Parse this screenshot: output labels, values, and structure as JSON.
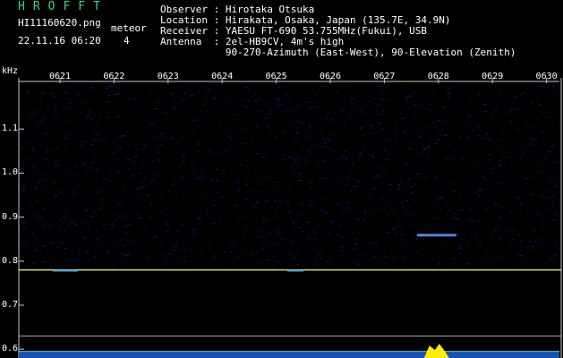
{
  "header": {
    "brand": "HROFFT",
    "filename": "HI11160620.png",
    "datetime": "22.11.16 06:20",
    "meteor_label": "meteor",
    "meteor_count": "4"
  },
  "observer_info": {
    "observer": "Observer : Hirotaka Otsuka",
    "location": "Location : Hirakata, Osaka, Japan (135.7E, 34.9N)",
    "receiver": "Receiver : YAESU FT-690 53.755MHz(Fukui), USB",
    "antenna": "Antenna  : 2el-HB9CV, 4m's high",
    "antenna_2": "           90-270-Azimuth (East-West), 90-Elevation (Zenith)"
  },
  "chart_data": {
    "type": "heatmap",
    "ylabel": "kHz",
    "x_ticks": [
      "0621",
      "0622",
      "0623",
      "0624",
      "0625",
      "0626",
      "0627",
      "0628",
      "0629",
      "0630"
    ],
    "y_ticks": [
      "1.1",
      "1.0",
      "0.9",
      "0.8",
      "0.7",
      "0.6"
    ],
    "ylim": [
      0.58,
      1.2
    ],
    "signals": [
      {
        "freq_khz": 0.78,
        "kind": "carrier"
      },
      {
        "freq_khz": 0.86,
        "kind": "meteor_echo",
        "time": "0628"
      },
      {
        "freq_khz": 0.59,
        "kind": "noise_band"
      }
    ],
    "colors": {
      "background": "#000000",
      "noise": "#1a1aa0",
      "carrier": "#ffff66",
      "axis": "#c8c8c8",
      "hot": "#ffee00"
    }
  }
}
